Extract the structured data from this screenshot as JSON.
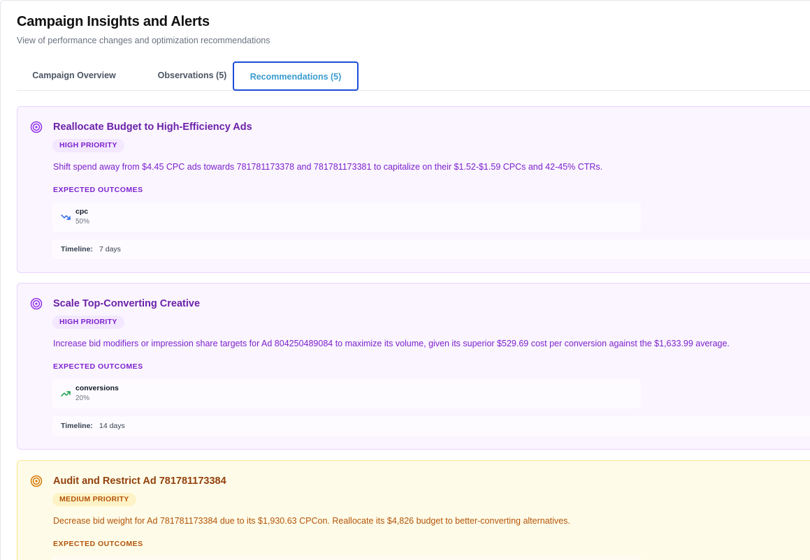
{
  "header": {
    "title": "Campaign Insights and Alerts",
    "subtitle": "View of performance changes and optimization recommendations"
  },
  "tabs": [
    {
      "label": "Campaign Overview",
      "active": false
    },
    {
      "label": "Observations (5)",
      "active": false
    },
    {
      "label": "Recommendations (5)",
      "active": true
    }
  ],
  "colors": {
    "high_priority_accent": "#7e22ce",
    "medium_priority_accent": "#b45309",
    "active_tab_border": "#1d4ed8",
    "trend_down": "#2563eb",
    "trend_up": "#16a34a"
  },
  "recommendations": [
    {
      "title": "Reallocate Budget to High-Efficiency Ads",
      "priority": "HIGH PRIORITY",
      "description": "Shift spend away from $4.45 CPC ads towards 781781173378 and 781781173381 to capitalize on their $1.52-$1.59 CPCs and 42-45% CTRs.",
      "outcomes_label": "EXPECTED OUTCOMES",
      "outcome": {
        "metric": "cpc",
        "value": "50%",
        "icon": "trend-down-icon"
      },
      "timeline_label": "Timeline:",
      "timeline": "7 days"
    },
    {
      "title": "Scale Top-Converting Creative",
      "priority": "HIGH PRIORITY",
      "description": "Increase bid modifiers or impression share targets for Ad 804250489084 to maximize its volume, given its superior $529.69 cost per conversion against the $1,633.99 average.",
      "outcomes_label": "EXPECTED OUTCOMES",
      "outcome": {
        "metric": "conversions",
        "value": "20%",
        "icon": "trend-up-icon"
      },
      "timeline_label": "Timeline:",
      "timeline": "14 days"
    },
    {
      "title": "Audit and Restrict Ad 781781173384",
      "priority": "MEDIUM PRIORITY",
      "description": "Decrease bid weight for Ad 781781173384 due to its $1,930.63 CPCon. Reallocate its $4,826 budget to better-converting alternatives.",
      "outcomes_label": "EXPECTED OUTCOMES"
    }
  ]
}
